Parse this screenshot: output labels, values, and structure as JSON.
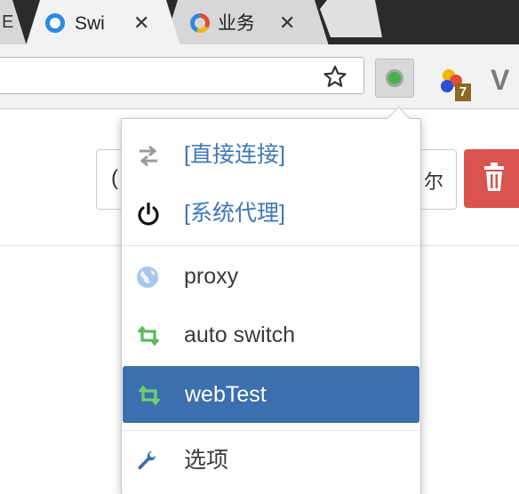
{
  "browser": {
    "tabs": [
      {
        "title": "Swi",
        "close_glyph": "✕",
        "icon": "blue-ring-icon",
        "active": true
      },
      {
        "title": "业务",
        "close_glyph": "✕",
        "icon": "color-ring-icon",
        "active": false
      }
    ],
    "left_stub_text": "E",
    "toolbar": {
      "star_icon": "star-icon",
      "extensions": [
        {
          "name": "proxy-switch-extension",
          "icon": "green-dot-icon"
        },
        {
          "name": "balls-extension",
          "icon": "balls-icon",
          "badge": "7"
        },
        {
          "name": "v-extension",
          "glyph": "V"
        }
      ]
    }
  },
  "page": {
    "left_button_glyph": "(",
    "left_button_text": "尔",
    "delete_icon": "trash-icon",
    "colors": {
      "delete": "#d9534f"
    }
  },
  "popup": {
    "items": [
      {
        "label": "[直接连接]",
        "icon": "swap-arrows-icon",
        "style": "link"
      },
      {
        "label": "[系统代理]",
        "icon": "power-icon",
        "style": "link"
      },
      {
        "label": "proxy",
        "icon": "globe-icon",
        "style": "dark"
      },
      {
        "label": "auto switch",
        "icon": "retweet-icon",
        "style": "dark"
      },
      {
        "label": "webTest",
        "icon": "retweet-icon",
        "style": "active"
      },
      {
        "label": "选项",
        "icon": "wrench-icon",
        "style": "dark"
      }
    ],
    "colors": {
      "active_bg": "#3b6fae",
      "link": "#3f78b8",
      "retweet_green": "#5cb85c"
    }
  }
}
